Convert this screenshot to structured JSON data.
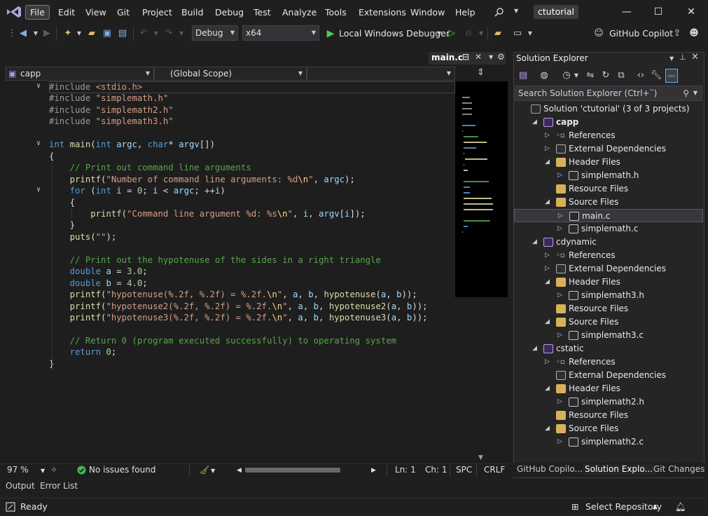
{
  "menu": {
    "items": [
      "File",
      "Edit",
      "View",
      "Git",
      "Project",
      "Build",
      "Debug",
      "Test",
      "Analyze",
      "Tools",
      "Extensions",
      "Window",
      "Help"
    ],
    "search_icon": "search-icon",
    "solution_name": "ctutorial"
  },
  "toolbar": {
    "configuration": "Debug",
    "platform": "x64",
    "run_label": "Local Windows Debugger",
    "copilot_label": "GitHub Copilot"
  },
  "editor": {
    "tab_label": "main.c",
    "project_combo": "capp",
    "scope_combo": "(Global Scope)",
    "zoom": "97 %",
    "issues": "No issues found",
    "line": "Ln: 1",
    "column": "Ch: 1",
    "whitespace": "SPC",
    "line_endings": "CRLF",
    "code_lines": [
      {
        "segments": [
          [
            "pp",
            "#include "
          ],
          [
            "str",
            "<stdio.h>"
          ]
        ]
      },
      {
        "segments": [
          [
            "pp",
            "#include "
          ],
          [
            "str",
            "\"simplemath.h\""
          ]
        ]
      },
      {
        "segments": [
          [
            "pp",
            "#include "
          ],
          [
            "str",
            "\"simplemath2.h\""
          ]
        ]
      },
      {
        "segments": [
          [
            "pp",
            "#include "
          ],
          [
            "str",
            "\"simplemath3.h\""
          ]
        ]
      },
      {
        "segments": []
      },
      {
        "segments": [
          [
            "kw",
            "int "
          ],
          [
            "fn",
            "main"
          ],
          [
            "plain",
            "("
          ],
          [
            "kw",
            "int "
          ],
          [
            "var",
            "argc"
          ],
          [
            "plain",
            ", "
          ],
          [
            "kw",
            "char"
          ],
          [
            "plain",
            "* "
          ],
          [
            "var",
            "argv"
          ],
          [
            "plain",
            "[])"
          ]
        ]
      },
      {
        "segments": [
          [
            "plain",
            "{"
          ]
        ]
      },
      {
        "segments": [
          [
            "plain",
            "    "
          ],
          [
            "cm",
            "// Print out command line arguments"
          ]
        ]
      },
      {
        "segments": [
          [
            "plain",
            "    "
          ],
          [
            "fn",
            "printf"
          ],
          [
            "plain",
            "("
          ],
          [
            "str",
            "\"Number of command line arguments: %d"
          ],
          [
            "esc",
            "\\n"
          ],
          [
            "str",
            "\""
          ],
          [
            "plain",
            ", "
          ],
          [
            "var",
            "argc"
          ],
          [
            "plain",
            ");"
          ]
        ]
      },
      {
        "segments": [
          [
            "plain",
            "    "
          ],
          [
            "kw",
            "for "
          ],
          [
            "plain",
            "("
          ],
          [
            "kw",
            "int "
          ],
          [
            "var",
            "i"
          ],
          [
            "plain",
            " = "
          ],
          [
            "num",
            "0"
          ],
          [
            "plain",
            "; "
          ],
          [
            "var",
            "i"
          ],
          [
            "plain",
            " < "
          ],
          [
            "var",
            "argc"
          ],
          [
            "plain",
            "; ++"
          ],
          [
            "var",
            "i"
          ],
          [
            "plain",
            ")"
          ]
        ]
      },
      {
        "segments": [
          [
            "plain",
            "    {"
          ]
        ]
      },
      {
        "segments": [
          [
            "plain",
            "        "
          ],
          [
            "fn",
            "printf"
          ],
          [
            "plain",
            "("
          ],
          [
            "str",
            "\"Command line argument %d: %s"
          ],
          [
            "esc",
            "\\n"
          ],
          [
            "str",
            "\""
          ],
          [
            "plain",
            ", "
          ],
          [
            "var",
            "i"
          ],
          [
            "plain",
            ", "
          ],
          [
            "var",
            "argv"
          ],
          [
            "plain",
            "["
          ],
          [
            "var",
            "i"
          ],
          [
            "plain",
            "]);"
          ]
        ]
      },
      {
        "segments": [
          [
            "plain",
            "    }"
          ]
        ]
      },
      {
        "segments": [
          [
            "plain",
            "    "
          ],
          [
            "fn",
            "puts"
          ],
          [
            "plain",
            "("
          ],
          [
            "str",
            "\"\""
          ],
          [
            "plain",
            ");"
          ]
        ]
      },
      {
        "segments": []
      },
      {
        "segments": [
          [
            "plain",
            "    "
          ],
          [
            "cm",
            "// Print out the hypotenuse of the sides in a right triangle"
          ]
        ]
      },
      {
        "segments": [
          [
            "plain",
            "    "
          ],
          [
            "kw",
            "double "
          ],
          [
            "var",
            "a"
          ],
          [
            "plain",
            " = "
          ],
          [
            "num",
            "3.0"
          ],
          [
            "plain",
            ";"
          ]
        ]
      },
      {
        "segments": [
          [
            "plain",
            "    "
          ],
          [
            "kw",
            "double "
          ],
          [
            "var",
            "b"
          ],
          [
            "plain",
            " = "
          ],
          [
            "num",
            "4.0"
          ],
          [
            "plain",
            ";"
          ]
        ]
      },
      {
        "segments": [
          [
            "plain",
            "    "
          ],
          [
            "fn",
            "printf"
          ],
          [
            "plain",
            "("
          ],
          [
            "str",
            "\"hypotenuse(%.2f, %.2f) = %.2f."
          ],
          [
            "esc",
            "\\n"
          ],
          [
            "str",
            "\""
          ],
          [
            "plain",
            ", "
          ],
          [
            "var",
            "a"
          ],
          [
            "plain",
            ", "
          ],
          [
            "var",
            "b"
          ],
          [
            "plain",
            ", "
          ],
          [
            "fn",
            "hypotenuse"
          ],
          [
            "plain",
            "("
          ],
          [
            "var",
            "a"
          ],
          [
            "plain",
            ", "
          ],
          [
            "var",
            "b"
          ],
          [
            "plain",
            "));"
          ]
        ]
      },
      {
        "segments": [
          [
            "plain",
            "    "
          ],
          [
            "fn",
            "printf"
          ],
          [
            "plain",
            "("
          ],
          [
            "str",
            "\"hypotenuse2(%.2f, %.2f) = %.2f."
          ],
          [
            "esc",
            "\\n"
          ],
          [
            "str",
            "\""
          ],
          [
            "plain",
            ", "
          ],
          [
            "var",
            "a"
          ],
          [
            "plain",
            ", "
          ],
          [
            "var",
            "b"
          ],
          [
            "plain",
            ", "
          ],
          [
            "fn",
            "hypotenuse2"
          ],
          [
            "plain",
            "("
          ],
          [
            "var",
            "a"
          ],
          [
            "plain",
            ", "
          ],
          [
            "var",
            "b"
          ],
          [
            "plain",
            "));"
          ]
        ]
      },
      {
        "segments": [
          [
            "plain",
            "    "
          ],
          [
            "fn",
            "printf"
          ],
          [
            "plain",
            "("
          ],
          [
            "str",
            "\"hypotenuse3(%.2f, %.2f) = %.2f."
          ],
          [
            "esc",
            "\\n"
          ],
          [
            "str",
            "\""
          ],
          [
            "plain",
            ", "
          ],
          [
            "var",
            "a"
          ],
          [
            "plain",
            ", "
          ],
          [
            "var",
            "b"
          ],
          [
            "plain",
            ", "
          ],
          [
            "fn",
            "hypotenuse3"
          ],
          [
            "plain",
            "("
          ],
          [
            "var",
            "a"
          ],
          [
            "plain",
            ", "
          ],
          [
            "var",
            "b"
          ],
          [
            "plain",
            "));"
          ]
        ]
      },
      {
        "segments": []
      },
      {
        "segments": [
          [
            "plain",
            "    "
          ],
          [
            "cm",
            "// Return 0 (program executed successfully) to operating system"
          ]
        ]
      },
      {
        "segments": [
          [
            "plain",
            "    "
          ],
          [
            "kw",
            "return "
          ],
          [
            "num",
            "0"
          ],
          [
            "plain",
            ";"
          ]
        ]
      },
      {
        "segments": [
          [
            "plain",
            "}"
          ]
        ]
      }
    ]
  },
  "solution_explorer": {
    "title": "Solution Explorer",
    "search_placeholder": "Search Solution Explorer (Ctrl+¨)",
    "tree": [
      {
        "label": "Solution 'ctutorial' (3 of 3 projects)",
        "icon": "sln",
        "level": 0,
        "expander": ""
      },
      {
        "label": "capp",
        "icon": "proj",
        "level": 1,
        "expander": "open",
        "bold": true
      },
      {
        "label": "References",
        "icon": "ref",
        "level": 2,
        "expander": "closed"
      },
      {
        "label": "External Dependencies",
        "icon": "ext",
        "level": 2,
        "expander": "closed"
      },
      {
        "label": "Header Files",
        "icon": "folder",
        "level": 2,
        "expander": "open"
      },
      {
        "label": "simplemath.h",
        "icon": "file",
        "level": 3,
        "expander": "closed"
      },
      {
        "label": "Resource Files",
        "icon": "folder",
        "level": 2,
        "expander": ""
      },
      {
        "label": "Source Files",
        "icon": "folder",
        "level": 2,
        "expander": "open"
      },
      {
        "label": "main.c",
        "icon": "file",
        "level": 3,
        "expander": "closed",
        "selected": true
      },
      {
        "label": "simplemath.c",
        "icon": "file",
        "level": 3,
        "expander": "closed"
      },
      {
        "label": "cdynamic",
        "icon": "proj",
        "level": 1,
        "expander": "open"
      },
      {
        "label": "References",
        "icon": "ref",
        "level": 2,
        "expander": "closed"
      },
      {
        "label": "External Dependencies",
        "icon": "ext",
        "level": 2,
        "expander": "closed"
      },
      {
        "label": "Header Files",
        "icon": "folder",
        "level": 2,
        "expander": "open"
      },
      {
        "label": "simplemath3.h",
        "icon": "file",
        "level": 3,
        "expander": "closed"
      },
      {
        "label": "Resource Files",
        "icon": "folder",
        "level": 2,
        "expander": ""
      },
      {
        "label": "Source Files",
        "icon": "folder",
        "level": 2,
        "expander": "open"
      },
      {
        "label": "simplemath3.c",
        "icon": "file",
        "level": 3,
        "expander": "closed"
      },
      {
        "label": "cstatic",
        "icon": "proj",
        "level": 1,
        "expander": "open"
      },
      {
        "label": "References",
        "icon": "ref",
        "level": 2,
        "expander": "closed"
      },
      {
        "label": "External Dependencies",
        "icon": "ext",
        "level": 2,
        "expander": ""
      },
      {
        "label": "Header Files",
        "icon": "folder",
        "level": 2,
        "expander": "open"
      },
      {
        "label": "simplemath2.h",
        "icon": "file",
        "level": 3,
        "expander": "closed"
      },
      {
        "label": "Resource Files",
        "icon": "folder",
        "level": 2,
        "expander": ""
      },
      {
        "label": "Source Files",
        "icon": "folder",
        "level": 2,
        "expander": "open"
      },
      {
        "label": "simplemath2.c",
        "icon": "file",
        "level": 3,
        "expander": "closed"
      }
    ],
    "bottom_tabs": [
      "GitHub Copilo...",
      "Solution Explo...",
      "Git Changes"
    ]
  },
  "bottom_panel": {
    "tabs": [
      "Output",
      "Error List"
    ]
  },
  "status_bar": {
    "ready": "Ready",
    "repository": "Select Repository"
  },
  "colors": {
    "accent": "#569cd6",
    "ok": "#3fb950"
  }
}
